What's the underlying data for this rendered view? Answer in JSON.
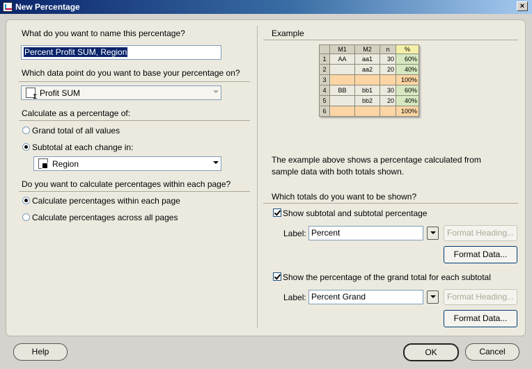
{
  "window": {
    "title": "New Percentage",
    "close": "×"
  },
  "left": {
    "name_question": "What do you want to name this percentage?",
    "name_value": "Percent Profit SUM, Region",
    "datapoint_question": "Which data point do you want to base your percentage on?",
    "datapoint_value": "Profit SUM",
    "calc_heading": "Calculate as a percentage of:",
    "option_grand": "Grand total of all values",
    "option_subtotal": "Subtotal at each change in:",
    "subtotal_value": "Region",
    "page_question": "Do you want to calculate percentages within each page?",
    "option_within": "Calculate percentages within each page",
    "option_across": "Calculate percentages across all pages"
  },
  "right": {
    "example_heading": "Example",
    "example_table": {
      "headers": [
        "",
        "M1",
        "M2",
        "n",
        "%"
      ],
      "rows": [
        [
          "1",
          "AA",
          "aa1",
          "30",
          "60%"
        ],
        [
          "2",
          "",
          "aa2",
          "20",
          "40%"
        ],
        [
          "3",
          "",
          "",
          "",
          "100%"
        ],
        [
          "4",
          "BB",
          "bb1",
          "30",
          "60%"
        ],
        [
          "5",
          "",
          "bb2",
          "20",
          "40%"
        ],
        [
          "6",
          "",
          "",
          "",
          "100%"
        ]
      ]
    },
    "desc_line1": "The example above shows a percentage calculated from",
    "desc_line2": "sample data with both totals shown.",
    "totals_question": "Which totals do you want to be shown?",
    "show_subtotal": "Show subtotal and subtotal percentage",
    "label_text": "Label:",
    "subtotal_label_value": "Percent",
    "format_heading": "Format Heading...",
    "format_data": "Format Data...",
    "show_grand": "Show the percentage of the grand total for each subtotal",
    "grand_label_value": "Percent Grand"
  },
  "footer": {
    "help": "Help",
    "ok": "OK",
    "cancel": "Cancel"
  }
}
